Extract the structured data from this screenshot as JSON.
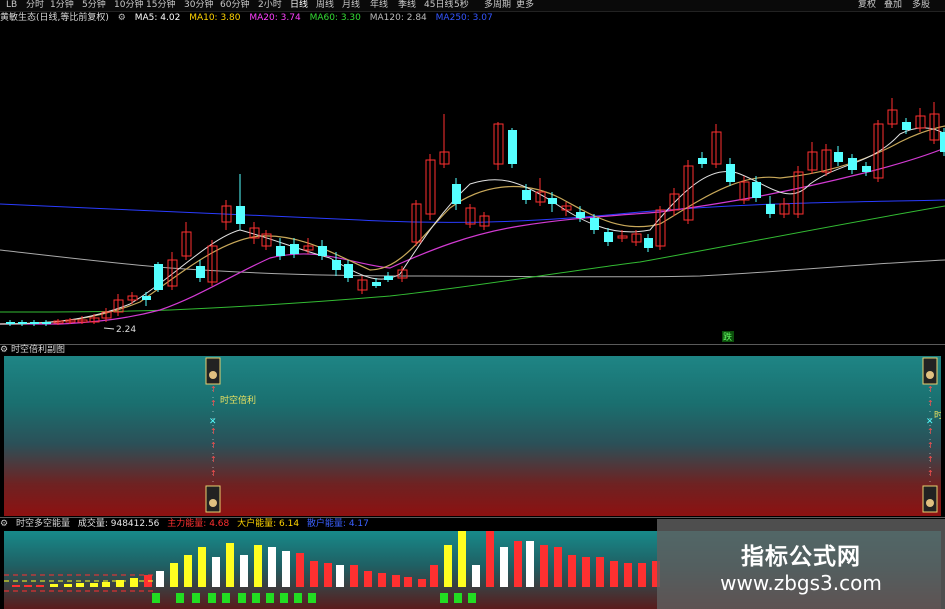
{
  "toolbar": {
    "items": [
      "LB",
      "分时",
      "1分钟",
      "5分钟",
      "10分钟",
      "15分钟",
      "30分钟",
      "60分钟",
      "2小时",
      "日线",
      "周线",
      "月线",
      "年线",
      "季线",
      "45日线",
      "5秒",
      "多周期",
      "更多"
    ],
    "active_index": 9,
    "right_items": [
      "复权",
      "叠加",
      "多股"
    ]
  },
  "indicator_bar": {
    "name": "黄敏生态(日线,等比前复权)",
    "mas": [
      {
        "label": "MA5: 4.02",
        "color": "#ffffff"
      },
      {
        "label": "MA10: 3.80",
        "color": "#ffd400"
      },
      {
        "label": "MA20: 3.74",
        "color": "#ff40ff"
      },
      {
        "label": "MA60: 3.30",
        "color": "#33dd33"
      },
      {
        "label": "MA120: 2.84",
        "color": "#bbbbbb"
      },
      {
        "label": "MA250: 3.07",
        "color": "#3355ff"
      }
    ]
  },
  "main_chart": {
    "low_label": "2.24",
    "marker_label": "跌",
    "candle_colors": {
      "up": "#ff3030",
      "down": "#55ffff"
    }
  },
  "pane2": {
    "title": "时空倍利副图",
    "label": "时空倍利",
    "right_label": "时"
  },
  "pane3": {
    "title": "时空多空能量",
    "vol_label": "成交量: 948412.56",
    "zhuli": {
      "label": "主力能量: 4.68",
      "color": "#ff3030"
    },
    "dahu": {
      "label": "大户能量: 6.14",
      "color": "#ffd400"
    },
    "sanhu": {
      "label": "散户能量: 4.17",
      "color": "#2050ff"
    }
  },
  "watermark": {
    "title": "指标公式网",
    "url": "www.zbgs3.com"
  },
  "colors": {
    "up": "#ff3030",
    "down": "#55ffff",
    "yellow": "#ffff20",
    "white": "#ffffff",
    "green": "#22dd22"
  }
}
